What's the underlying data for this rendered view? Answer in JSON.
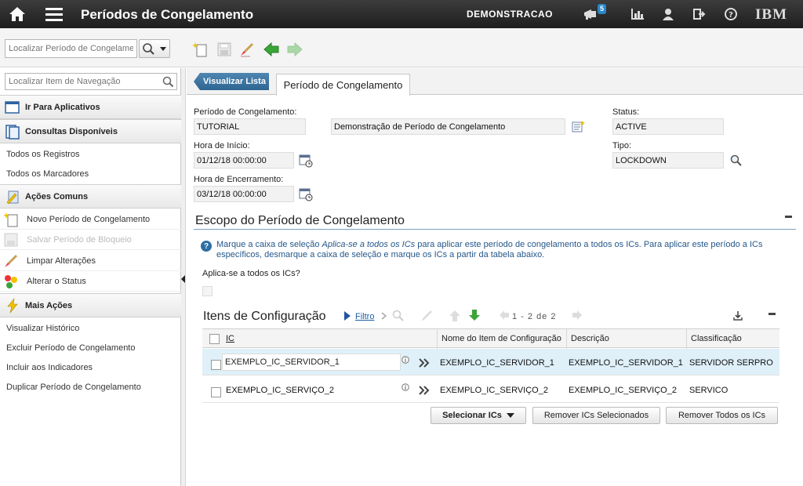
{
  "header": {
    "app_title": "Períodos de Congelamento",
    "user_name": "DEMONSTRACAO",
    "notification_count": "5",
    "brand": "IBM"
  },
  "toolbar": {
    "find_placeholder": "Localizar Período de Congelamento"
  },
  "sidebar": {
    "nav_search_placeholder": "Localizar Item de Navegação",
    "goto_apps": "Ir Para Aplicativos",
    "queries_title": "Consultas Disponíveis",
    "queries": [
      "Todos os Registros",
      "Todos os Marcadores"
    ],
    "common_actions_title": "Ações Comuns",
    "common_actions": [
      "Novo Período de Congelamento",
      "Salvar Período de Bloqueio",
      "Limpar Alterações",
      "Alterar o Status"
    ],
    "more_actions_title": "Mais Ações",
    "more_actions": [
      "Visualizar Histórico",
      "Excluir Período de Congelamento",
      "Incluir aos Indicadores",
      "Duplicar Período de Congelamento"
    ]
  },
  "tabs": {
    "list_tab": "Visualizar Lista",
    "current_tab": "Período de Congelamento"
  },
  "form": {
    "period_label": "Período de Congelamento:",
    "period_value": "TUTORIAL",
    "description_value": "Demonstração de Período de Congelamento",
    "status_label": "Status:",
    "status_value": "ACTIVE",
    "start_label": "Hora de Início:",
    "start_value": "01/12/18 00:00:00",
    "type_label": "Tipo:",
    "type_value": "LOCKDOWN",
    "end_label": "Hora de Encerramento:",
    "end_value": "03/12/18 00:00:00"
  },
  "scope": {
    "title": "Escopo do Período de Congelamento",
    "help_part1": "Marque a caixa de seleção ",
    "help_emphasis": "Aplica-se a todos os ICs",
    "help_part2": " para aplicar este período de congelamento a todos os ICs. Para aplicar este período a ICs específicos, desmarque a caixa de seleção e marque os ICs a partir da tabela abaixo.",
    "applies_all_label": "Aplica-se a todos os ICs?"
  },
  "ci_table": {
    "title": "Itens de Configuração",
    "filter_label": "Filtro",
    "pager": "1 - 2 de 2",
    "columns": [
      "IC",
      "Nome do Item de Configuração",
      "Descrição",
      "Classificação"
    ],
    "rows": [
      {
        "ic": "EXEMPLO_IC_SERVIDOR_1",
        "name": "EXEMPLO_IC_SERVIDOR_1",
        "description": "EXEMPLO_IC_SERVIDOR_1",
        "classification": "SERVIDOR SERPRO"
      },
      {
        "ic": "EXEMPLO_IC_SERVIÇO_2",
        "name": "EXEMPLO_IC_SERVIÇO_2",
        "description": "EXEMPLO_IC_SERVIÇO_2",
        "classification": "SERVICO"
      }
    ],
    "select_button": "Selecionar ICs",
    "remove_selected_button": "Remover ICs Selecionados",
    "remove_all_button": "Remover Todos os ICs"
  }
}
